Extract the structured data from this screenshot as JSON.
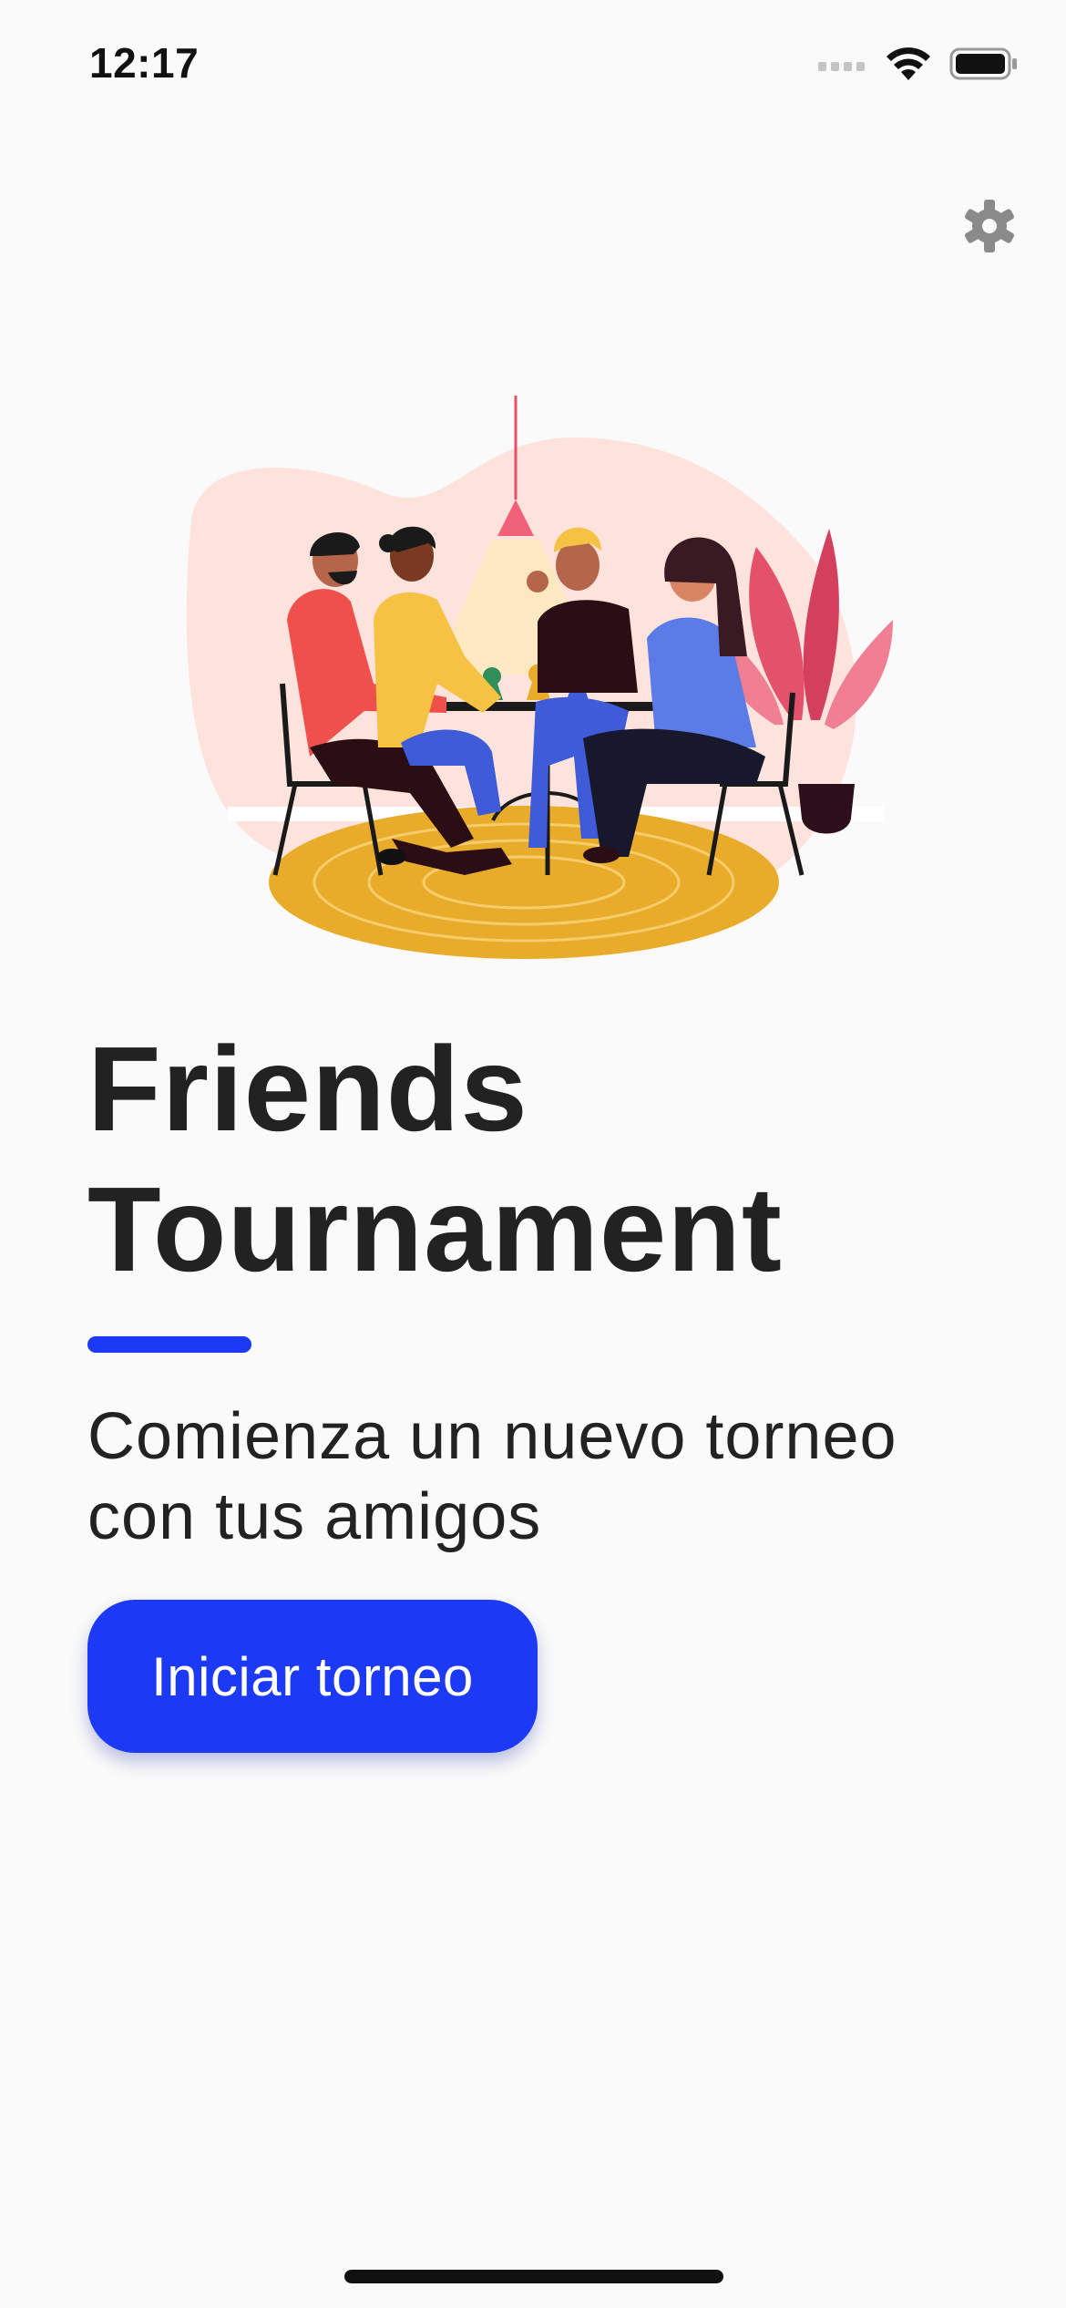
{
  "status_bar": {
    "time": "12:17",
    "icons": [
      "cellular-signal-icon",
      "wifi-icon",
      "battery-icon"
    ]
  },
  "header": {
    "settings_icon": "gear-icon"
  },
  "hero": {
    "illustration": "friends-playing-board-game-illustration"
  },
  "main": {
    "title_line1": "Friends",
    "title_line2": "Tournament",
    "subtitle_line1": "Comienza un nuevo torneo",
    "subtitle_line2": "con tus amigos",
    "start_button_label": "Iniciar torneo"
  },
  "colors": {
    "accent": "#1c3af5",
    "background": "#fafafa",
    "text": "#222222",
    "icon_gray": "#8a8a8a"
  }
}
